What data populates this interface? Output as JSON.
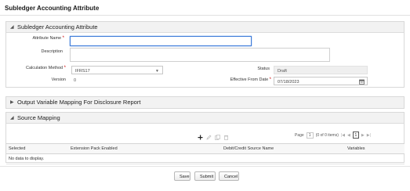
{
  "page": {
    "title": "Subledger Accounting Attribute"
  },
  "main_panel": {
    "title": "Subledger Accounting Attribute",
    "required_mark": "*",
    "fields": {
      "attribute_name": {
        "label": "Attribute Name",
        "value": ""
      },
      "description": {
        "label": "Description",
        "value": ""
      },
      "calculation_method": {
        "label": "Calculation Method",
        "value": "IFRS17"
      },
      "status": {
        "label": "Status",
        "value": "Draft"
      },
      "version": {
        "label": "Version",
        "value": "0"
      },
      "effective_from_date": {
        "label": "Effective From Date",
        "value": "07/18/2023"
      }
    }
  },
  "output_panel": {
    "title": "Output Variable Mapping For Disclosure Report"
  },
  "source_panel": {
    "title": "Source Mapping",
    "pager": {
      "page_label": "Page",
      "page_value": "1",
      "items_text": "(0 of 0 items)",
      "current_page": "1"
    },
    "columns": [
      "Selected",
      "Extension Pack Enabled",
      "Debit/Credit Source Name",
      "Variables"
    ],
    "empty_text": "No data to display."
  },
  "buttons": {
    "save": "Save",
    "submit": "Submit",
    "cancel": "Cancel"
  },
  "colors": {
    "focus_border": "#3d7bd9",
    "required": "#cc0000",
    "header_bg": "#f2f2f2"
  }
}
